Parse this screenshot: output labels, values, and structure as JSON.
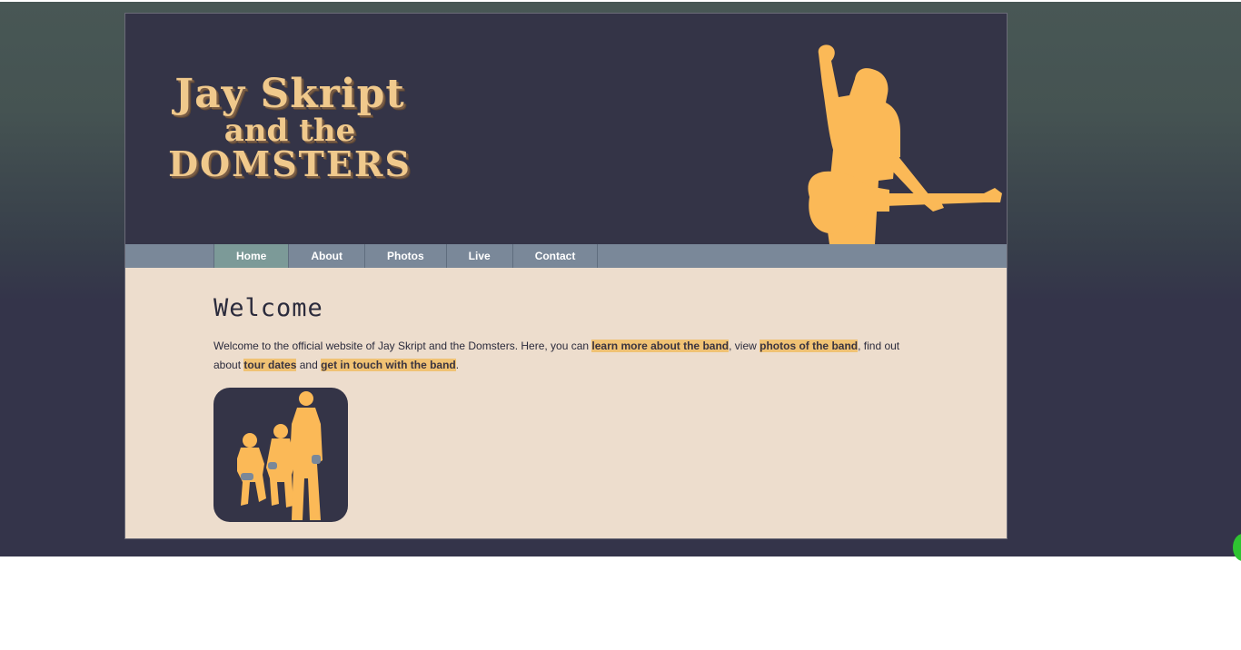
{
  "header": {
    "logo_line1": "Jay Skript",
    "logo_line2": "and the",
    "logo_line3": "DOMSTERS"
  },
  "nav": {
    "items": [
      {
        "label": "Home",
        "active": true
      },
      {
        "label": "About"
      },
      {
        "label": "Photos"
      },
      {
        "label": "Live"
      },
      {
        "label": "Contact"
      }
    ]
  },
  "main": {
    "title": "Welcome",
    "intro_part1": "Welcome to the official website of Jay Skript and the Domsters. Here, you can ",
    "link_about": "learn more about the band",
    "intro_part2": ", view ",
    "link_photos": "photos of the band",
    "intro_part3": ", find out about ",
    "link_live": "tour dates",
    "intro_part4": " and ",
    "link_contact": "get in touch with the band",
    "intro_part5": "."
  },
  "colors": {
    "header_bg": "#343447",
    "accent": "#f0c274",
    "silhouette": "#fbb957",
    "nav_bg": "#7a8899",
    "content_bg": "#edddcd"
  }
}
